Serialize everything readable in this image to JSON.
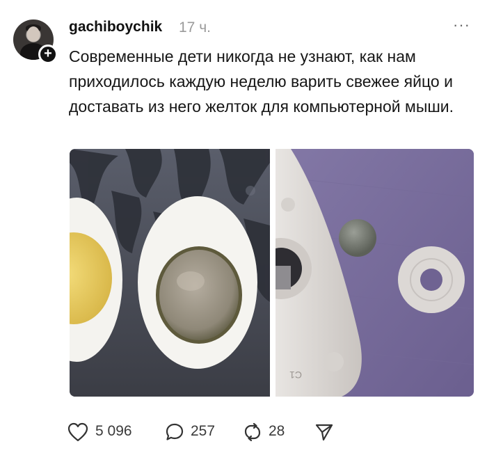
{
  "post": {
    "author": "gachiboychik",
    "time": "17 ч.",
    "follow_symbol": "+",
    "more_symbol": "···",
    "text": "Современные дети никогда не узнают, как нам приходилось каждую неделю варить свежее яйцо и доставать из него желток для компьютерной мыши."
  },
  "media": {
    "images": [
      "egg-halves-photo",
      "mouse-ball-parts-photo"
    ]
  },
  "actions": {
    "likes": "5 096",
    "replies": "257",
    "reposts": "28"
  },
  "icons": {
    "like": "heart-icon",
    "reply": "speech-bubble-icon",
    "repost": "repost-arrows-icon",
    "share": "paper-plane-icon"
  }
}
